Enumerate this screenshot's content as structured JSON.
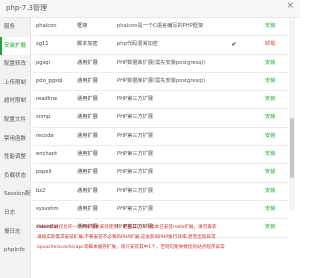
{
  "window": {
    "title": "php-7.3管理",
    "close_glyph": "×"
  },
  "sidebar": {
    "items": [
      {
        "label": "服务",
        "active": false
      },
      {
        "label": "安装扩展",
        "active": true
      },
      {
        "label": "配置修改",
        "active": false
      },
      {
        "label": "上传限制",
        "active": false
      },
      {
        "label": "超时限制",
        "active": false
      },
      {
        "label": "配置文件",
        "active": false
      },
      {
        "label": "禁用函数",
        "active": false
      },
      {
        "label": "性能调整",
        "active": false
      },
      {
        "label": "负载状态",
        "active": false
      },
      {
        "label": "Session配置",
        "active": false
      },
      {
        "label": "日志",
        "active": false
      },
      {
        "label": "慢日志",
        "active": false
      },
      {
        "label": "phpinfo",
        "active": false
      }
    ]
  },
  "extensions": [
    {
      "name": "phalcon",
      "type": "框架",
      "desc": "phalcon是一个C语言编写的PHP框架",
      "check": "",
      "status": "",
      "op": "安装"
    },
    {
      "name": "sg11",
      "type": "脚本加密",
      "desc": "php代码混淆加密",
      "check": "✔",
      "status": "",
      "op": "卸载"
    },
    {
      "name": "pgsql",
      "type": "通用扩展",
      "desc": "PHP数据库扩展(需先安装postgresql)",
      "check": "",
      "status": "",
      "op": "安装"
    },
    {
      "name": "pdo_pgsql",
      "type": "通用扩展",
      "desc": "PHP数据库扩展(需先安装postgresql)",
      "check": "",
      "status": "",
      "op": "安装"
    },
    {
      "name": "readline",
      "type": "通用扩展",
      "desc": "PHP第三方扩展",
      "check": "",
      "status": "",
      "op": "安装"
    },
    {
      "name": "snmp",
      "type": "通用扩展",
      "desc": "PHP第三方扩展",
      "check": "",
      "status": "",
      "op": "安装"
    },
    {
      "name": "recode",
      "type": "通用扩展",
      "desc": "PHP第三方扩展",
      "check": "",
      "status": "",
      "op": "安装"
    },
    {
      "name": "enchant",
      "type": "通用扩展",
      "desc": "PHP第三方扩展",
      "check": "",
      "status": "",
      "op": "安装"
    },
    {
      "name": "pspell",
      "type": "通用扩展",
      "desc": "PHP第三方扩展",
      "check": "",
      "status": "",
      "op": "安装"
    },
    {
      "name": "bz2",
      "type": "通用扩展",
      "desc": "PHP第三方扩展",
      "check": "",
      "status": "",
      "op": "安装"
    },
    {
      "name": "sysvshm",
      "type": "通用扩展",
      "desc": "PHP第三方扩展",
      "check": "",
      "status": "",
      "op": "安装"
    },
    {
      "name": "calendar",
      "type": "通用扩展",
      "desc": "PHP第三方扩展",
      "check": "",
      "status": "",
      "op": "安装"
    }
  ],
  "notes": [
    "Redis扩展仅允许一个PHP版本安装使用，若在其它PHP版本已安装redis扩展，请勿再装",
    "请按实际需求安装扩展,不要安装不必要的PHP扩展,这会影响PHP执行效率,甚至出现异常",
    "opcache/xcache/apc等脚本缓存扩展，请只安装其中1个，否则可能导致您的站点程序异常"
  ],
  "colors": {
    "accent": "#20a53a",
    "danger": "#d9534f",
    "note": "#c9302c"
  }
}
